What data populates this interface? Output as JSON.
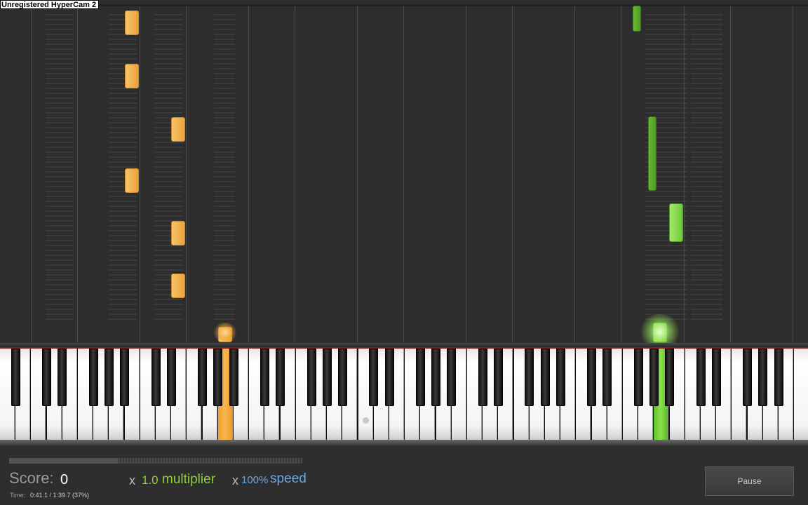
{
  "recorder": {
    "watermark": "Unregistered HyperCam 2"
  },
  "status": {
    "score_label": "Score:",
    "score_value": "0",
    "multiplier_prefix": "x",
    "multiplier_value": "1.0",
    "multiplier_label": "multiplier",
    "speed_prefix": "x",
    "speed_value": "100%",
    "speed_label": "speed",
    "time_label": "Time:",
    "time_value": "0:41.1 / 1:39.7 (37%)",
    "progress_fraction": 0.37
  },
  "controls": {
    "pause_label": "Pause"
  },
  "colors": {
    "left_hand": "#eea53a",
    "right_hand": "#7fd444",
    "multiplier": "#8bd13a",
    "speed": "#6fa8dc"
  }
}
